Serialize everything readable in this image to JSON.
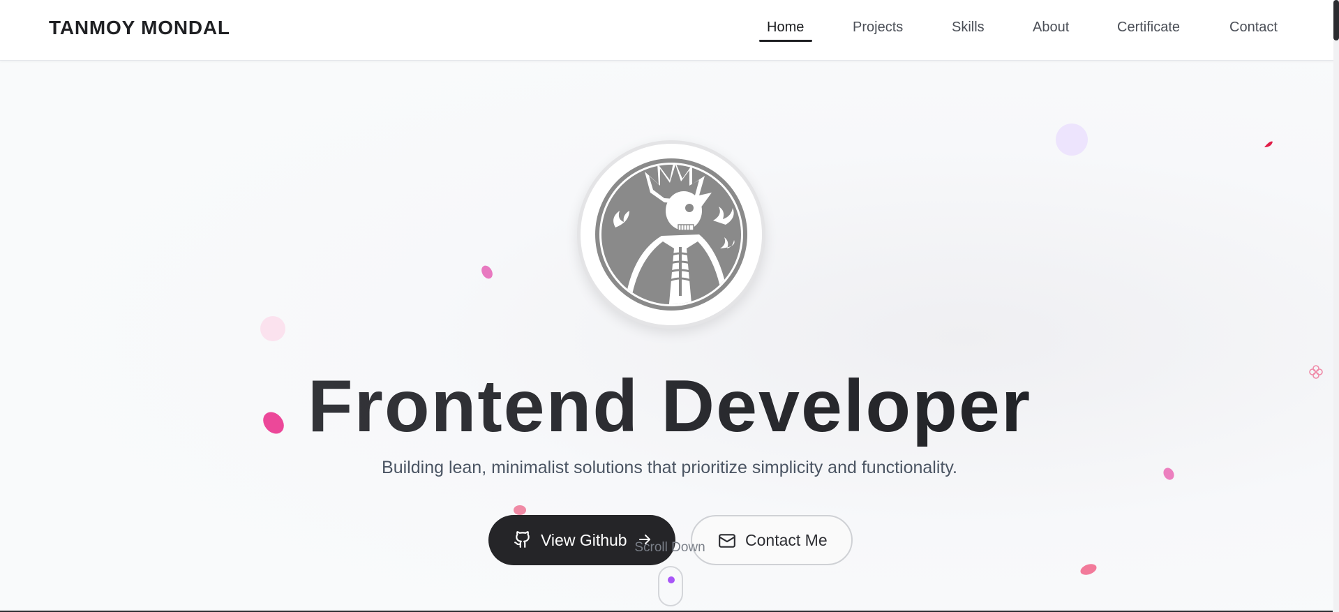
{
  "navbar": {
    "brand": "TANMOY MONDAL",
    "items": [
      {
        "label": "Home",
        "active": true
      },
      {
        "label": "Projects"
      },
      {
        "label": "Skills"
      },
      {
        "label": "About"
      },
      {
        "label": "Certificate"
      },
      {
        "label": "Contact"
      }
    ]
  },
  "hero": {
    "avatar_icon": "skeleton-samurai-avatar",
    "headline": "Frontend Developer",
    "tagline": "Building lean, minimalist solutions that prioritize simplicity and functionality.",
    "primary_button": {
      "label": "View Github",
      "icon": "github-icon",
      "trailing_icon": "arrow-right-icon"
    },
    "secondary_button": {
      "label": "Contact Me",
      "icon": "mail-icon"
    },
    "scroll_hint": "Scroll Down"
  },
  "colors": {
    "accent": "#a855f7",
    "petal_pink": "#ec4899",
    "petal_red": "#e11d48",
    "dark": "#252528"
  }
}
